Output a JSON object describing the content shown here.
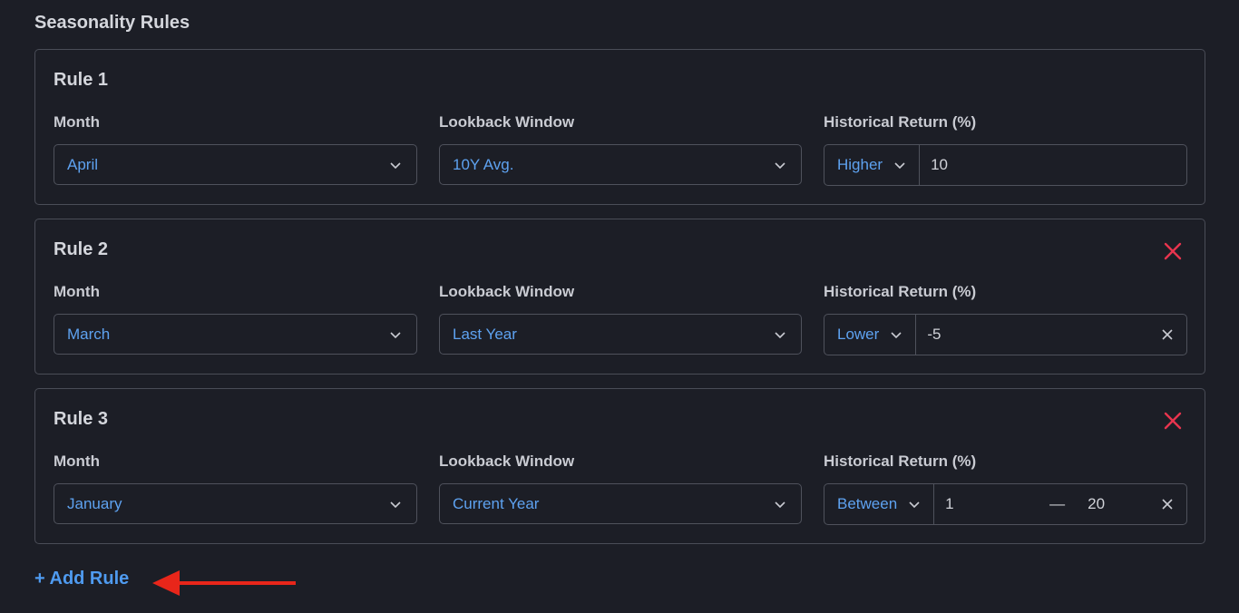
{
  "section": {
    "title": "Seasonality Rules"
  },
  "labels": {
    "month": "Month",
    "lookback": "Lookback Window",
    "historical_return": "Historical Return (%)"
  },
  "rules": [
    {
      "title": "Rule 1",
      "month": "April",
      "lookback": "10Y Avg.",
      "operator": "Higher",
      "value": "10",
      "removable": false
    },
    {
      "title": "Rule 2",
      "month": "March",
      "lookback": "Last Year",
      "operator": "Lower",
      "value": "-5",
      "removable": true
    },
    {
      "title": "Rule 3",
      "month": "January",
      "lookback": "Current Year",
      "operator": "Between",
      "value": "1",
      "value_to": "20",
      "range_separator": "—",
      "removable": true
    }
  ],
  "actions": {
    "add_rule": "+ Add Rule"
  },
  "colors": {
    "accent": "#4f9bf0",
    "remove": "#e8344e",
    "annotation_arrow": "#e8261a",
    "background": "#1c1e26",
    "border": "#4a4d57"
  }
}
